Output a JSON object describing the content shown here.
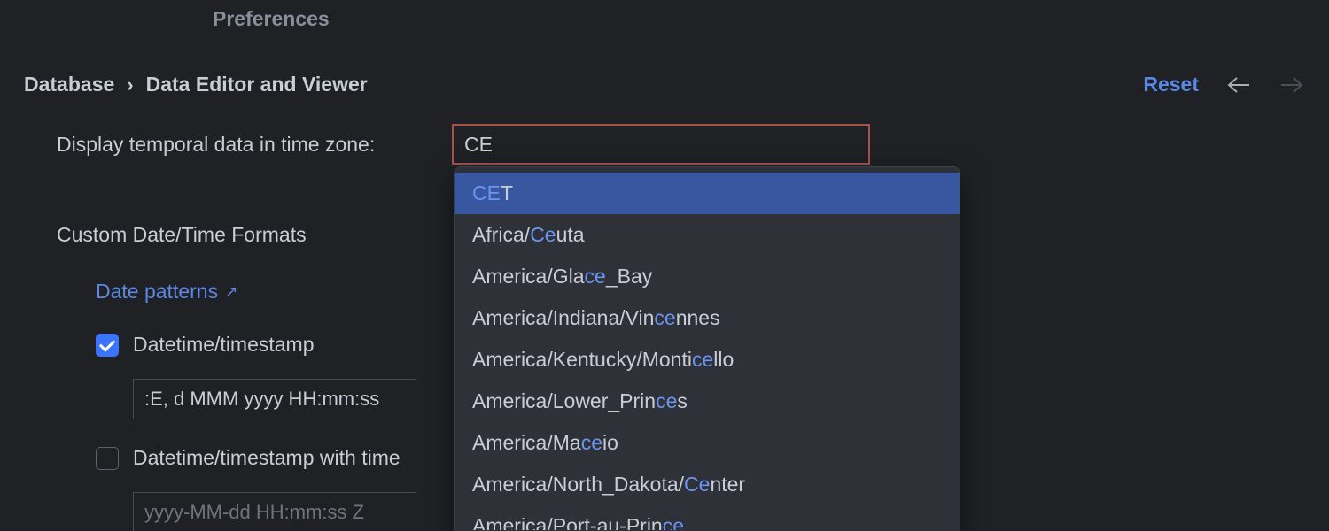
{
  "window_title": "Preferences",
  "breadcrumb": {
    "root": "Database",
    "leaf": "Data Editor and Viewer",
    "sep": "›"
  },
  "actions": {
    "reset": "Reset"
  },
  "timezone": {
    "label": "Display temporal data in time zone:",
    "input_value": "CE",
    "options": [
      {
        "text": "CET",
        "match": [
          0,
          2
        ],
        "selected": true
      },
      {
        "text": "Africa/Ceuta",
        "match": [
          7,
          9
        ]
      },
      {
        "text": "America/Glace_Bay",
        "match": [
          11,
          13
        ]
      },
      {
        "text": "America/Indiana/Vincennes",
        "match": [
          19,
          21
        ]
      },
      {
        "text": "America/Kentucky/Monticello",
        "match": [
          22,
          24
        ]
      },
      {
        "text": "America/Lower_Princes",
        "match": [
          18,
          20
        ]
      },
      {
        "text": "America/Maceio",
        "match": [
          10,
          12
        ]
      },
      {
        "text": "America/North_Dakota/Center",
        "match": [
          21,
          23
        ]
      },
      {
        "text": "America/Port-au-Prince",
        "match": [
          20,
          22
        ],
        "truncated": true
      }
    ]
  },
  "section_heading": "Custom Date/Time Formats",
  "link_patterns": "Date patterns",
  "formats": {
    "datetime": {
      "label": "Datetime/timestamp",
      "checked": true,
      "value": ":E, d MMM yyyy HH:mm:ss"
    },
    "datetime_tz": {
      "label": "Datetime/timestamp with time",
      "checked": false,
      "value": "yyyy-MM-dd HH:mm:ss Z"
    }
  }
}
